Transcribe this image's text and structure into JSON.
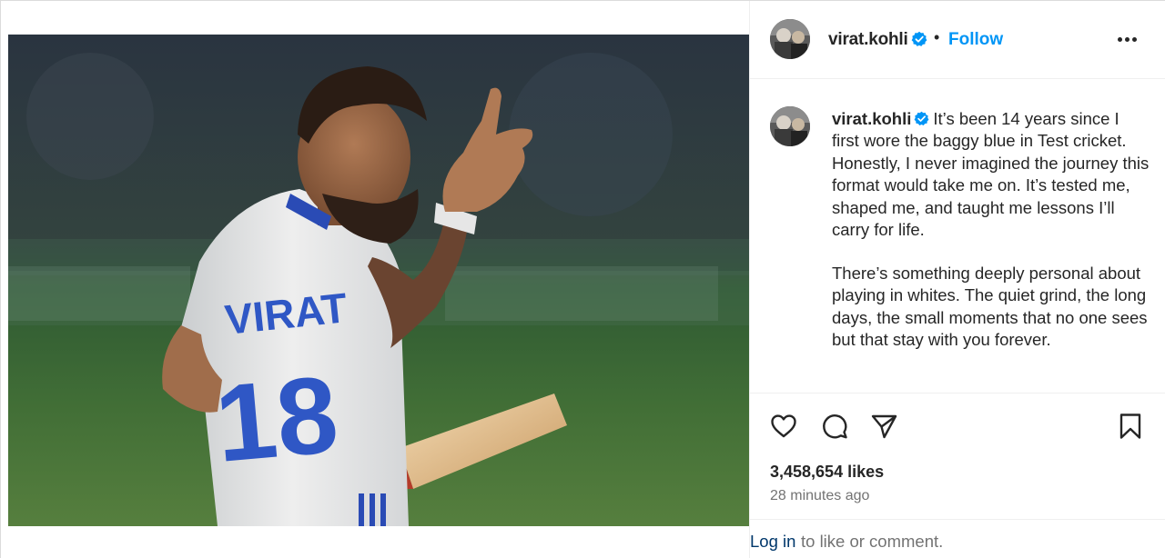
{
  "post": {
    "username": "virat.kohli",
    "verified": true,
    "follow_label": "Follow",
    "separator": "•",
    "caption_para1": "It’s been 14 years since I first wore the baggy blue in Test cricket. Honestly, I never imagined the journey this format would take me on. It’s tested me, shaped me, and taught me lessons I’ll carry for life.",
    "caption_para2": "There’s something deeply personal about playing in whites. The quiet grind, the long days, the small moments that no one sees but that stay with you forever.",
    "likes": "3,458,654 likes",
    "timestamp": "28 minutes ago",
    "login_link": "Log in",
    "login_rest": "to like or comment."
  },
  "icons": {
    "verified": "verified-badge-icon",
    "more": "more-options-icon",
    "like": "heart-icon",
    "comment": "comment-bubble-icon",
    "share": "paper-plane-icon",
    "save": "bookmark-icon"
  },
  "colors": {
    "accent": "#0095f6",
    "login_link": "#00376b",
    "muted_text": "#737373"
  }
}
